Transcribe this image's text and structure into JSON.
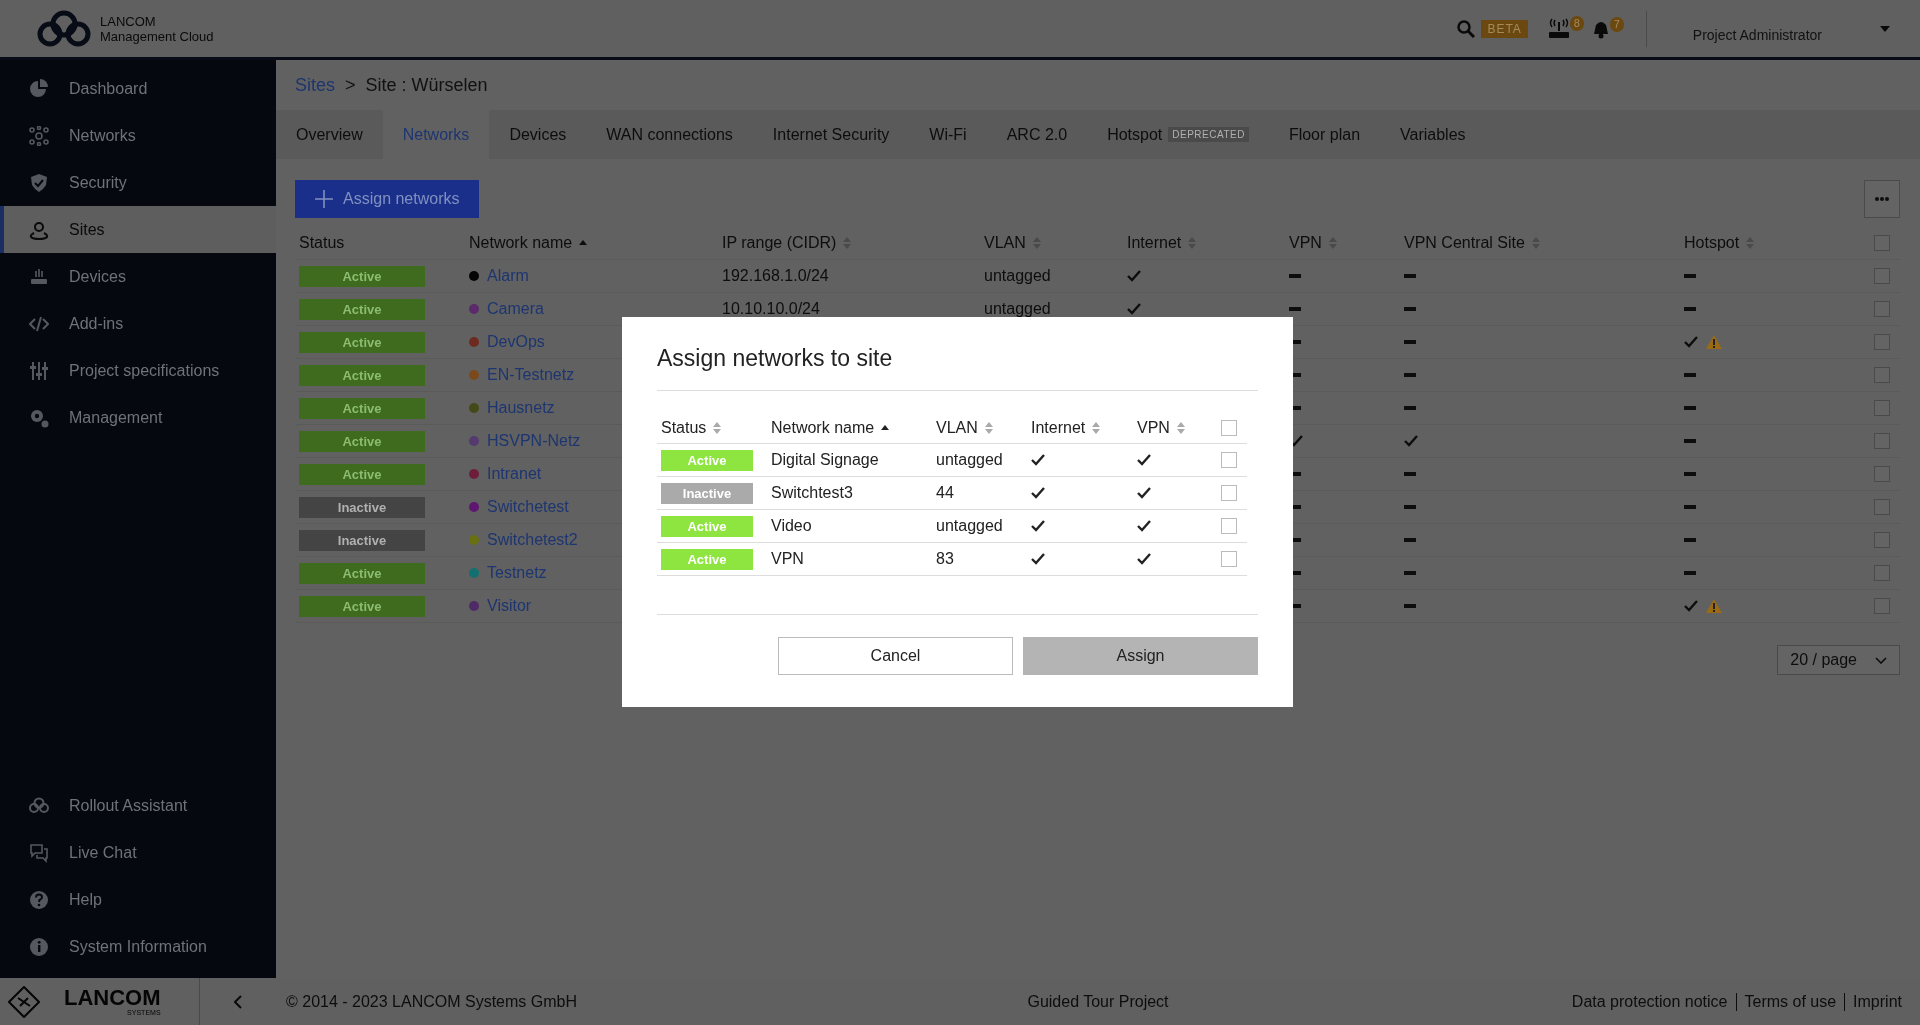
{
  "header": {
    "brand": "LANCOM",
    "product": "Management Cloud",
    "search_badge": "BETA",
    "device_count": "8",
    "alert_count": "7",
    "user": "Project Administrator"
  },
  "sidebar": {
    "items": [
      {
        "label": "Dashboard",
        "selected": false
      },
      {
        "label": "Networks",
        "selected": false
      },
      {
        "label": "Security",
        "selected": false
      },
      {
        "label": "Sites",
        "selected": true
      },
      {
        "label": "Devices",
        "selected": false
      },
      {
        "label": "Add-ins",
        "selected": false
      },
      {
        "label": "Project specifications",
        "selected": false
      },
      {
        "label": "Management",
        "selected": false
      }
    ],
    "bottom_items": [
      {
        "label": "Rollout Assistant"
      },
      {
        "label": "Live Chat"
      },
      {
        "label": "Help"
      },
      {
        "label": "System Information"
      }
    ],
    "logo_text": "LANCOM",
    "logo_sub": "SYSTEMS"
  },
  "breadcrumb": {
    "parent": "Sites",
    "separator": ">",
    "current": "Site : Würselen"
  },
  "tabs": [
    {
      "label": "Overview",
      "selected": false
    },
    {
      "label": "Networks",
      "selected": true
    },
    {
      "label": "Devices",
      "selected": false
    },
    {
      "label": "WAN connections",
      "selected": false
    },
    {
      "label": "Internet Security",
      "selected": false
    },
    {
      "label": "Wi-Fi",
      "selected": false
    },
    {
      "label": "ARC 2.0",
      "selected": false
    },
    {
      "label": "Hotspot",
      "selected": false,
      "badge": "DEPRECATED"
    },
    {
      "label": "Floor plan",
      "selected": false
    },
    {
      "label": "Variables",
      "selected": false
    }
  ],
  "toolbar": {
    "assign_button": "Assign networks"
  },
  "table": {
    "columns": [
      {
        "label": "Status",
        "sortable": false,
        "sorted_ascending": false
      },
      {
        "label": "Network name",
        "sortable": true,
        "sorted_ascending": true
      },
      {
        "label": "IP range (CIDR)",
        "sortable": true,
        "sorted_ascending": false
      },
      {
        "label": "VLAN",
        "sortable": true,
        "sorted_ascending": false
      },
      {
        "label": "Internet",
        "sortable": true,
        "sorted_ascending": false
      },
      {
        "label": "VPN",
        "sortable": true,
        "sorted_ascending": false
      },
      {
        "label": "VPN Central Site",
        "sortable": true,
        "sorted_ascending": false
      },
      {
        "label": "Hotspot",
        "sortable": true,
        "sorted_ascending": false
      }
    ],
    "select_all_checked": false,
    "rows": [
      {
        "status": "Active",
        "active": true,
        "name": "Alarm",
        "color": "#050505",
        "ip": "192.168.1.0/24",
        "vlan": "untagged",
        "internet": true,
        "vpn": false,
        "vpn_central": false,
        "hotspot": false,
        "checked": false
      },
      {
        "status": "Active",
        "active": true,
        "name": "Camera",
        "color": "#5a2a6a",
        "ip": "10.10.10.0/24",
        "vlan": "untagged",
        "internet": true,
        "vpn": false,
        "vpn_central": false,
        "hotspot": false,
        "checked": false
      },
      {
        "status": "Active",
        "active": true,
        "name": "DevOps",
        "color": "#6e2a20",
        "vpn": false,
        "vpn_central": false,
        "hotspot": true,
        "hotspot_warning": true,
        "checked": false
      },
      {
        "status": "Active",
        "active": true,
        "name": "EN-Testnetz",
        "color": "#7a4a1c",
        "vpn": false,
        "vpn_central": false,
        "hotspot": false,
        "checked": false
      },
      {
        "status": "Active",
        "active": true,
        "name": "Hausnetz",
        "color": "#444a16",
        "vpn": false,
        "vpn_central": false,
        "hotspot": false,
        "checked": false
      },
      {
        "status": "Active",
        "active": true,
        "name": "HSVPN-Netz",
        "color": "#553a70",
        "vpn": true,
        "vpn_central": true,
        "hotspot": false,
        "checked": false
      },
      {
        "status": "Active",
        "active": true,
        "name": "Intranet",
        "color": "#6e1e3a",
        "vpn": false,
        "vpn_central": false,
        "hotspot": false,
        "checked": false
      },
      {
        "status": "Inactive",
        "active": false,
        "name": "Switchetest",
        "color": "#5e1670",
        "vpn": false,
        "vpn_central": false,
        "hotspot": false,
        "checked": false
      },
      {
        "status": "Inactive",
        "active": false,
        "name": "Switchetest2",
        "color": "#687012",
        "vpn": false,
        "vpn_central": false,
        "hotspot": false,
        "checked": false
      },
      {
        "status": "Active",
        "active": true,
        "name": "Testnetz",
        "color": "#127070",
        "vpn": false,
        "vpn_central": false,
        "hotspot": false,
        "checked": false
      },
      {
        "status": "Active",
        "active": true,
        "name": "Visitor",
        "color": "#4e2a66",
        "vpn": false,
        "vpn_central": false,
        "hotspot": true,
        "hotspot_warning": true,
        "checked": false
      }
    ]
  },
  "pagination": {
    "page_size": "20 / page"
  },
  "modal": {
    "title": "Assign networks to site",
    "columns": [
      {
        "label": "Status",
        "sortable": true,
        "sorted_ascending": false
      },
      {
        "label": "Network name",
        "sortable": true,
        "sorted_ascending": true
      },
      {
        "label": "VLAN",
        "sortable": true,
        "sorted_ascending": false
      },
      {
        "label": "Internet",
        "sortable": true,
        "sorted_ascending": false
      },
      {
        "label": "VPN",
        "sortable": true,
        "sorted_ascending": false
      }
    ],
    "select_all_checked": false,
    "rows": [
      {
        "status": "Active",
        "active": true,
        "name": "Digital Signage",
        "vlan": "untagged",
        "internet": true,
        "vpn": true,
        "checked": false
      },
      {
        "status": "Inactive",
        "active": false,
        "name": "Switchtest3",
        "vlan": "44",
        "internet": true,
        "vpn": true,
        "checked": false
      },
      {
        "status": "Active",
        "active": true,
        "name": "Video",
        "vlan": "untagged",
        "internet": true,
        "vpn": true,
        "checked": false
      },
      {
        "status": "Active",
        "active": true,
        "name": "VPN",
        "vlan": "83",
        "internet": true,
        "vpn": true,
        "checked": false
      }
    ],
    "cancel": "Cancel",
    "assign": {
      "label": "Assign",
      "disabled": true
    }
  },
  "footer": {
    "copyright": "© 2014 - 2023 LANCOM Systems GmbH",
    "project": "Guided Tour Project",
    "links": [
      "Data protection notice",
      "Terms of use",
      "Imprint"
    ]
  }
}
